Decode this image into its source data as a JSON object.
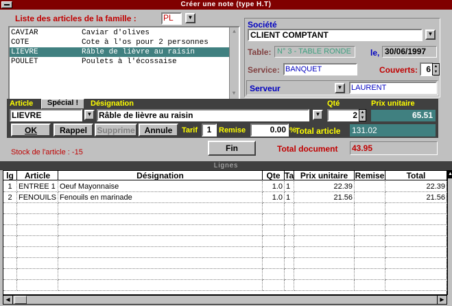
{
  "window": {
    "title": "Créer une note (type H.T)"
  },
  "articles": {
    "header_label": "Liste des articles de la famille :",
    "family_value": "PL",
    "items": [
      {
        "code": "CAVIAR",
        "label": "Caviar d'olives"
      },
      {
        "code": "COTE",
        "label": "Cote à l'os pour 2 personnes"
      },
      {
        "code": "LIEVRE",
        "label": "Râble de lièvre au raisin"
      },
      {
        "code": "POULET",
        "label": "Poulets à l'écossaise"
      }
    ],
    "selected_index": 2
  },
  "client": {
    "societe_label": "Société",
    "societe_value": "CLIENT COMPTANT",
    "table_label": "Table:",
    "table_value": "N° 3 - TABLE RONDE",
    "date_label": "le,",
    "date_value": "30/06/1997",
    "service_label": "Service:",
    "service_value": "BANQUET",
    "couverts_label": "Couverts:",
    "couverts_value": "6",
    "serveur_label": "Serveur",
    "serveur_value": "LAURENT"
  },
  "entry": {
    "article_label": "Article",
    "special_label": "Spécial !",
    "designation_label": "Désignation",
    "qte_label": "Qté",
    "prix_label": "Prix unitaire",
    "article_value": "LIEVRE",
    "designation_value": "Râble de lièvre au raisin",
    "qte_value": "2",
    "prix_value": "65.51"
  },
  "actions": {
    "ok": "OK",
    "rappel": "Rappel",
    "supprime": "Supprime",
    "annule": "Annule",
    "tarif_label": "Tarif",
    "tarif_value": "1",
    "remise_label": "Remise",
    "remise_value": "0.00",
    "pct": "%",
    "total_article_label": "Total article",
    "total_article_value": "131.02",
    "fin": "Fin",
    "stock_text": "Stock de l'article : -15",
    "total_document_label": "Total document",
    "total_document_value": "43.95"
  },
  "lignes": {
    "title": "Lignes",
    "columns": [
      "lg",
      "Article",
      "Désignation",
      "Qte",
      "Ta",
      "Prix unitaire",
      "Remise",
      "Total"
    ],
    "rows": [
      {
        "lg": "1",
        "article": "ENTREE 1",
        "designation": "Oeuf Mayonnaise",
        "qte": "1.0",
        "ta": "1",
        "prix": "22.39",
        "remise": "",
        "total": "22.39"
      },
      {
        "lg": "2",
        "article": "FENOUILS",
        "designation": "Fenouils en marinade",
        "qte": "1.0",
        "ta": "1",
        "prix": "21.56",
        "remise": "",
        "total": "21.56"
      }
    ]
  },
  "icons": {
    "dropdown": "dropdown-arrow-icon",
    "spin": "spin-arrows-icon",
    "scroll_up": "scroll-up-icon",
    "scroll_down": "scroll-down-icon",
    "scroll_left": "scroll-left-icon",
    "scroll_right": "scroll-right-icon"
  },
  "colors": {
    "title_bg": "#800000",
    "dark_panel": "#404040",
    "selection": "#408080",
    "accent_red": "#c00000",
    "accent_blue": "#0000c0",
    "accent_yellow": "#ffff00"
  }
}
